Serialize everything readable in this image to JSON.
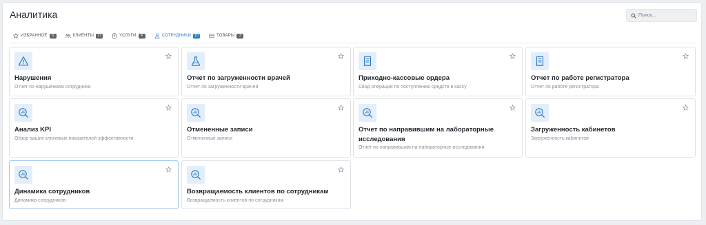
{
  "header": {
    "title": "Аналитика",
    "search": {
      "placeholder": "Поиск...",
      "value": "",
      "icon": "search-icon"
    }
  },
  "tabs": [
    {
      "label": "ИЗБРАННОЕ",
      "count": "0",
      "icon": "star-icon",
      "active": false
    },
    {
      "label": "КЛИЕНТЫ",
      "count": "17",
      "icon": "users-icon",
      "active": false
    },
    {
      "label": "УСЛУГИ",
      "count": "4",
      "icon": "clipboard-icon",
      "active": false
    },
    {
      "label": "СОТРУДНИКИ",
      "count": "10",
      "icon": "user-icon",
      "active": true
    },
    {
      "label": "ТОВАРЫ",
      "count": "3",
      "icon": "box-icon",
      "active": false
    }
  ],
  "cards": [
    {
      "title": "Нарушения",
      "description": "Отчет по нарушениям сотрудника",
      "icon": "warning-icon"
    },
    {
      "title": "Отчет по загруженности врачей",
      "description": "Отчет по загруженности врачей",
      "icon": "flask-icon"
    },
    {
      "title": "Приходно-кассовые ордера",
      "description": "Свод операций по поступлению средств в кассу",
      "icon": "receipt-icon"
    },
    {
      "title": "Отчет по работе регистратора",
      "description": "Отчет по работе регистратора",
      "icon": "receipt-icon"
    },
    {
      "title": "Анализ KPI",
      "description": "Обзор ваших ключевых показателей эффективности",
      "icon": "chart-search-icon"
    },
    {
      "title": "Отмененные записи",
      "description": "Отмененные записи",
      "icon": "chart-search-icon"
    },
    {
      "title": "Отчет по направившим на лабораторные исследования",
      "description": "Отчет по направившим на лабораторные исследования",
      "icon": "chart-search-icon"
    },
    {
      "title": "Загруженность кабинетов",
      "description": "Загруженность кабинетов",
      "icon": "chart-search-icon"
    },
    {
      "title": "Динамика сотрудников",
      "description": "Динамика сотрудников",
      "icon": "chart-search-icon",
      "selected": true
    },
    {
      "title": "Возвращаемость клиентов по сотрудникам",
      "description": "Возвращаемость клиентов по сотрудникам",
      "icon": "chart-search-icon"
    }
  ],
  "colors": {
    "accent": "#2b78c5",
    "icon_bg": "#e3eefb",
    "badge": "#5d636b"
  }
}
